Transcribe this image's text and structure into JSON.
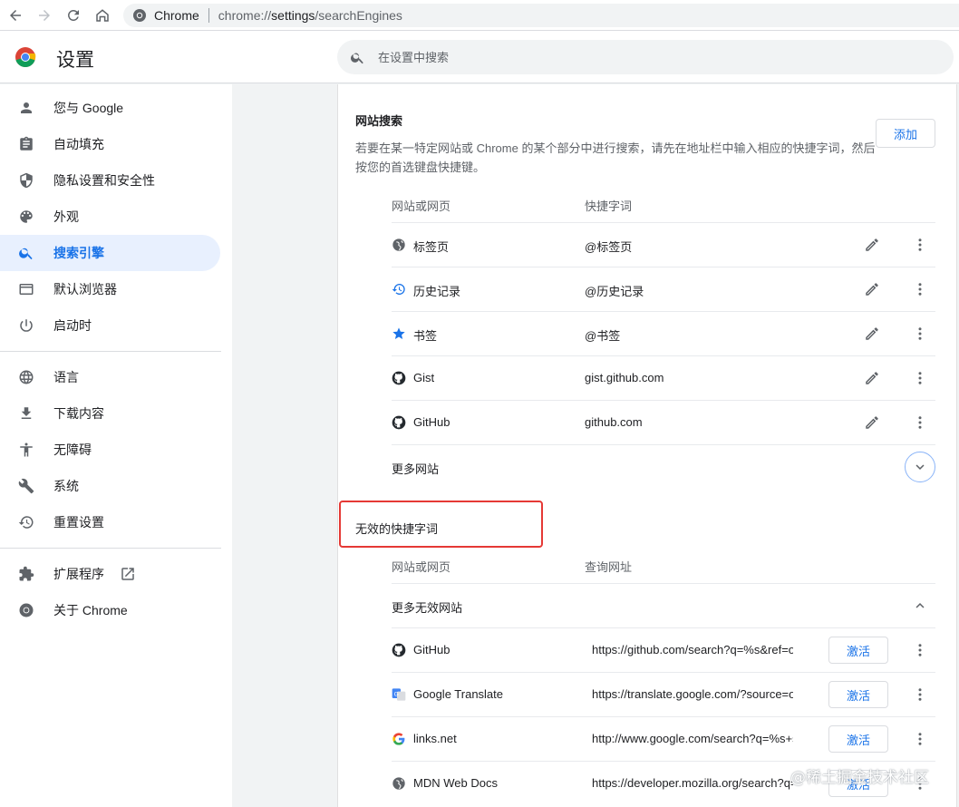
{
  "browser": {
    "site_name": "Chrome",
    "url_prefix": "chrome://",
    "url_host": "settings",
    "url_path": "/searchEngines"
  },
  "header": {
    "title": "设置",
    "search_placeholder": "在设置中搜索"
  },
  "sidebar": {
    "items": [
      {
        "label": "您与 Google",
        "icon": "person-icon"
      },
      {
        "label": "自动填充",
        "icon": "clipboard-icon"
      },
      {
        "label": "隐私设置和安全性",
        "icon": "shield-icon"
      },
      {
        "label": "外观",
        "icon": "palette-icon"
      },
      {
        "label": "搜索引擎",
        "icon": "search-icon",
        "active": true
      },
      {
        "label": "默认浏览器",
        "icon": "browser-icon"
      },
      {
        "label": "启动时",
        "icon": "power-icon"
      },
      {
        "label": "语言",
        "icon": "globe-icon"
      },
      {
        "label": "下载内容",
        "icon": "download-icon"
      },
      {
        "label": "无障碍",
        "icon": "accessibility-icon"
      },
      {
        "label": "系统",
        "icon": "wrench-icon"
      },
      {
        "label": "重置设置",
        "icon": "restore-icon"
      },
      {
        "label": "扩展程序",
        "icon": "puzzle-icon"
      },
      {
        "label": "关于 Chrome",
        "icon": "chrome-icon"
      }
    ]
  },
  "site_search": {
    "title": "网站搜索",
    "description": "若要在某一特定网站或 Chrome 的某个部分中进行搜索，请先在地址栏中输入相应的快捷字词，然后按您的首选键盘快捷键。",
    "add_label": "添加",
    "col_site": "网站或网页",
    "col_keyword": "快捷字词",
    "rows": [
      {
        "name": "标签页",
        "keyword": "@标签页",
        "icon": "globe-icon"
      },
      {
        "name": "历史记录",
        "keyword": "@历史记录",
        "icon": "history-icon"
      },
      {
        "name": "书签",
        "keyword": "@书签",
        "icon": "star-icon"
      },
      {
        "name": "Gist",
        "keyword": "gist.github.com",
        "icon": "github-icon"
      },
      {
        "name": "GitHub",
        "keyword": "github.com",
        "icon": "github-icon"
      }
    ],
    "more_label": "更多网站"
  },
  "inactive": {
    "title": "无效的快捷字词",
    "col_site": "网站或网页",
    "col_url": "查询网址",
    "more_label": "更多无效网站",
    "activate_label": "激活",
    "rows": [
      {
        "name": "GitHub",
        "url": "https://github.com/search?q=%s&ref=opensearch",
        "icon": "github-icon"
      },
      {
        "name": "Google Translate",
        "url": "https://translate.google.com/?source=osdd",
        "icon": "google-translate-icon"
      },
      {
        "name": "links.net",
        "url": "http://www.google.com/search?q=%s+site:links.net",
        "icon": "google-icon"
      },
      {
        "name": "MDN Web Docs",
        "url": "https://developer.mozilla.org/search?q=%s",
        "icon": "globe-icon"
      }
    ]
  },
  "watermark": "@稀土掘金技术社区",
  "colors": {
    "accent": "#1a73e8",
    "highlight": "#e53935"
  }
}
